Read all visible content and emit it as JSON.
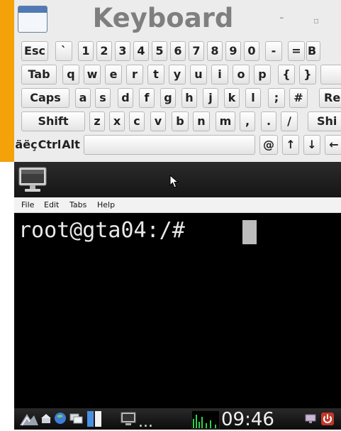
{
  "keyboard": {
    "title": "Keyboard",
    "minimize_glyph": "-",
    "maximize_glyph": "▫",
    "rows": [
      [
        "Esc",
        "`",
        "1",
        "2",
        "3",
        "4",
        "5",
        "6",
        "7",
        "8",
        "9",
        "0",
        "-",
        "=",
        "B"
      ],
      [
        "Tab",
        "q",
        "w",
        "e",
        "r",
        "t",
        "y",
        "u",
        "i",
        "o",
        "p",
        "{",
        "}",
        ""
      ],
      [
        "Caps",
        "a",
        "s",
        "d",
        "f",
        "g",
        "h",
        "j",
        "k",
        "l",
        ";",
        "#",
        "Re"
      ],
      [
        "Shift",
        "z",
        "x",
        "c",
        "v",
        "b",
        "n",
        "m",
        ",",
        ".",
        "/",
        "Shi"
      ],
      [
        "äëç",
        "Ctrl",
        "Alt",
        "",
        "@",
        "↑",
        "↓",
        "←"
      ]
    ]
  },
  "terminal": {
    "menu": [
      "File",
      "Edit",
      "Tabs",
      "Help"
    ],
    "prompt": "root@gta04:/# "
  },
  "taskbar": {
    "clock": "09:46",
    "ellipsis": "..."
  }
}
